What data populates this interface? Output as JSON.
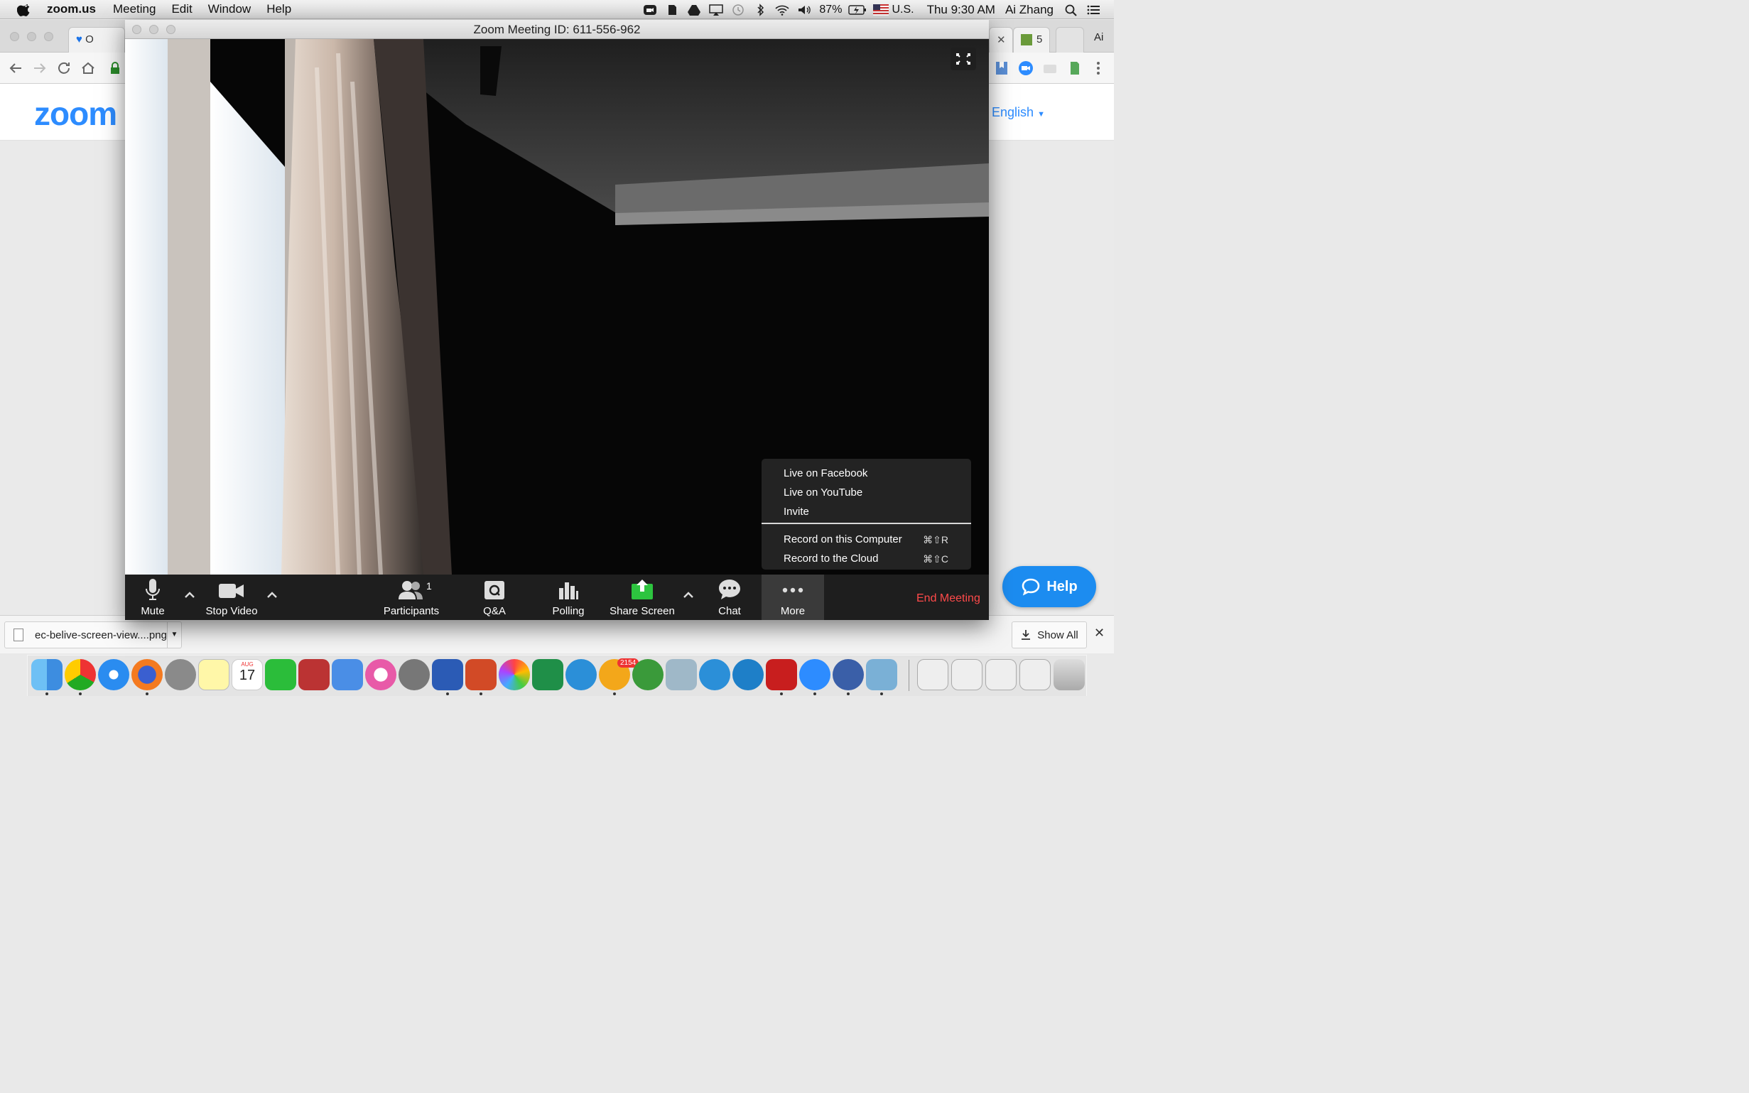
{
  "menubar": {
    "app_name": "zoom.us",
    "menus": [
      "Meeting",
      "Edit",
      "Window",
      "Help"
    ],
    "battery": "87%",
    "input_source": "U.S.",
    "clock": "Thu 9:30 AM",
    "user": "Ai Zhang"
  },
  "browser": {
    "tabs": [
      {
        "label": "O"
      },
      {
        "label": "5"
      },
      {
        "label": "Ai"
      }
    ],
    "site_logo": "zoom",
    "language": "English",
    "help_label": "Help",
    "downloads": {
      "file_name": "ec-belive-screen-view....png",
      "show_all_label": "Show All"
    }
  },
  "zoom_window": {
    "title": "Zoom Meeting ID: 611-556-962",
    "toolbar": {
      "mute": "Mute",
      "stop_video": "Stop Video",
      "participants": "Participants",
      "participant_count": "1",
      "qa": "Q&A",
      "polling": "Polling",
      "share_screen": "Share Screen",
      "chat": "Chat",
      "more": "More",
      "end_meeting": "End Meeting"
    },
    "more_menu": {
      "items": [
        {
          "label": "Live on Facebook"
        },
        {
          "label": "Live on YouTube"
        },
        {
          "label": "Invite"
        },
        {
          "label": "Record on this Computer",
          "shortcut": "⌘⇧R"
        },
        {
          "label": "Record to the Cloud",
          "shortcut": "⌘⇧C"
        }
      ]
    }
  },
  "dock": {
    "calendar_date": "17",
    "calendar_month": "AUG",
    "mail_badge": "2154"
  },
  "colors": {
    "zoom_blue": "#2d8cff",
    "end_meeting_red": "#ff4a4a",
    "share_green": "#2dc43f",
    "toolbar_bg": "#1e1e1e"
  }
}
